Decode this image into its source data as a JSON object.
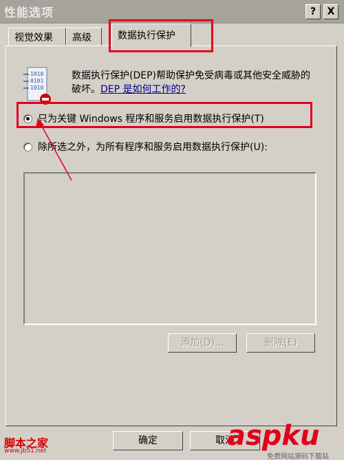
{
  "window": {
    "title": "性能选项",
    "help_button": "?",
    "close_button": "X"
  },
  "tabs": [
    {
      "label": "视觉效果"
    },
    {
      "label": "高级"
    },
    {
      "label": "数据执行保护"
    }
  ],
  "dep": {
    "description": "数据执行保护(DEP)帮助保护免受病毒或其他安全威胁的破坏。",
    "link": "DEP 是如何工作的?",
    "options": [
      {
        "label": "只为关键 Windows 程序和服务启用数据执行保护(T)",
        "checked": true
      },
      {
        "label": "除所选之外，为所有程序和服务启用数据执行保护(U):",
        "checked": false
      }
    ]
  },
  "list_buttons": {
    "add": "添加(D)...",
    "remove": "删除(E)"
  },
  "footer": {
    "ok": "确定",
    "cancel": "取消"
  },
  "watermarks": {
    "left_main": "脚本之家",
    "left_sub": "www.jb51.net",
    "right_main": "aspku",
    "right_sub": "免费网站源码下载站"
  },
  "colors": {
    "highlight": "#e3001b",
    "face": "#d4d0c8"
  }
}
